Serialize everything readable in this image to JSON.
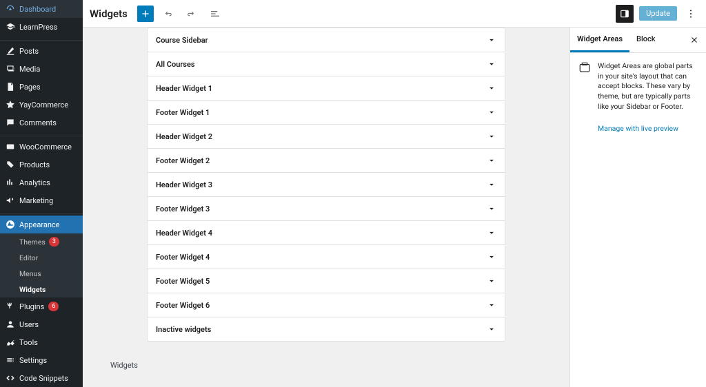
{
  "sidebar": {
    "items": [
      {
        "icon": "dashboard",
        "label": "Dashboard"
      },
      {
        "icon": "learnpress",
        "label": "LearnPress"
      },
      {
        "separator": true
      },
      {
        "icon": "posts",
        "label": "Posts"
      },
      {
        "icon": "media",
        "label": "Media"
      },
      {
        "icon": "pages",
        "label": "Pages"
      },
      {
        "icon": "yay",
        "label": "YayCommerce"
      },
      {
        "icon": "comments",
        "label": "Comments"
      },
      {
        "separator": true
      },
      {
        "icon": "woo",
        "label": "WooCommerce"
      },
      {
        "icon": "products",
        "label": "Products"
      },
      {
        "icon": "analytics",
        "label": "Analytics"
      },
      {
        "icon": "marketing",
        "label": "Marketing"
      },
      {
        "separator": true
      },
      {
        "icon": "appearance",
        "label": "Appearance",
        "current": true
      },
      {
        "icon": "plugins",
        "label": "Plugins",
        "badge": "6"
      },
      {
        "icon": "users",
        "label": "Users"
      },
      {
        "icon": "tools",
        "label": "Tools"
      },
      {
        "icon": "settings",
        "label": "Settings"
      },
      {
        "icon": "snippets",
        "label": "Code Snippets"
      }
    ],
    "submenu": [
      {
        "label": "Themes",
        "badge": "3"
      },
      {
        "label": "Editor"
      },
      {
        "label": "Menus"
      },
      {
        "label": "Widgets",
        "active": true
      }
    ]
  },
  "topbar": {
    "title": "Widgets",
    "update_label": "Update"
  },
  "widgets": [
    "Course Sidebar",
    "All Courses",
    "Header Widget 1",
    "Footer Widget 1",
    "Header Widget 2",
    "Footer Widget 2",
    "Header Widget 3",
    "Footer Widget 3",
    "Header Widget 4",
    "Footer Widget 4",
    "Footer Widget 5",
    "Footer Widget 6",
    "Inactive widgets"
  ],
  "footer_label": "Widgets",
  "inspector": {
    "tabs": {
      "areas": "Widget Areas",
      "block": "Block"
    },
    "description": "Widget Areas are global parts in your site's layout that can accept blocks. These vary by theme, but are typically parts like your Sidebar or Footer.",
    "link": "Manage with live preview"
  }
}
